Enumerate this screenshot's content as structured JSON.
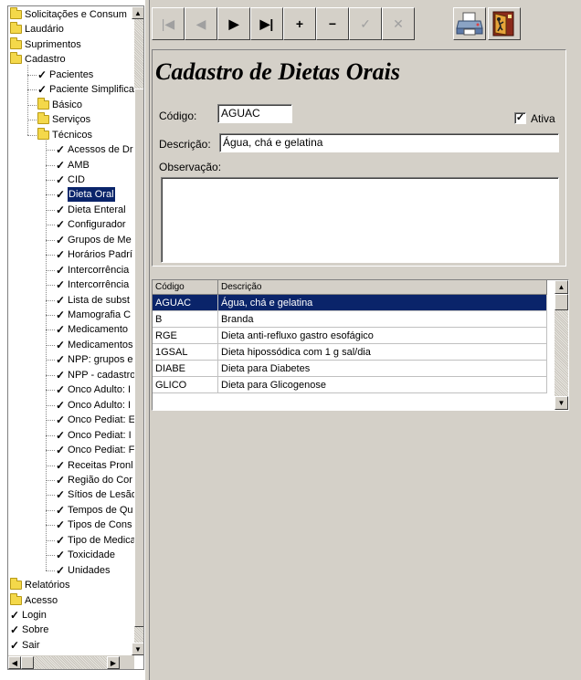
{
  "tree": {
    "items": [
      {
        "label": "Solicitações e Consum",
        "icon": "folder-icon",
        "level": 0
      },
      {
        "label": "Laudário",
        "icon": "folder-icon",
        "level": 0
      },
      {
        "label": "Suprimentos",
        "icon": "folder-icon",
        "level": 0
      },
      {
        "label": "Cadastro",
        "icon": "folder-icon",
        "level": 0
      },
      {
        "label": "Pacientes",
        "icon": "check-icon",
        "level": 1
      },
      {
        "label": "Paciente Simplifica",
        "icon": "check-icon",
        "level": 1
      },
      {
        "label": "Básico",
        "icon": "folder-icon",
        "level": 1
      },
      {
        "label": "Serviços",
        "icon": "folder-icon",
        "level": 1
      },
      {
        "label": "Técnicos",
        "icon": "folder-icon",
        "level": 1
      },
      {
        "label": "Acessos de Dr",
        "icon": "check-icon",
        "level": 2
      },
      {
        "label": "AMB",
        "icon": "check-icon",
        "level": 2
      },
      {
        "label": "CID",
        "icon": "check-icon",
        "level": 2
      },
      {
        "label": "Dieta Oral",
        "icon": "check-icon",
        "level": 2,
        "selected": true
      },
      {
        "label": "Dieta Enteral",
        "icon": "check-icon",
        "level": 2
      },
      {
        "label": "Configurador",
        "icon": "check-icon",
        "level": 2
      },
      {
        "label": "Grupos de Me",
        "icon": "check-icon",
        "level": 2
      },
      {
        "label": "Horários Padrí",
        "icon": "check-icon",
        "level": 2
      },
      {
        "label": "Intercorrência",
        "icon": "check-icon",
        "level": 2
      },
      {
        "label": "Intercorrência",
        "icon": "check-icon",
        "level": 2
      },
      {
        "label": "Lista de subst",
        "icon": "check-icon",
        "level": 2
      },
      {
        "label": "Mamografia C",
        "icon": "check-icon",
        "level": 2
      },
      {
        "label": "Medicamento",
        "icon": "check-icon",
        "level": 2
      },
      {
        "label": "Medicamentos",
        "icon": "check-icon",
        "level": 2
      },
      {
        "label": "NPP: grupos e",
        "icon": "check-icon",
        "level": 2
      },
      {
        "label": "NPP - cadastro",
        "icon": "check-icon",
        "level": 2
      },
      {
        "label": "Onco Adulto: I",
        "icon": "check-icon",
        "level": 2
      },
      {
        "label": "Onco Adulto: I",
        "icon": "check-icon",
        "level": 2
      },
      {
        "label": "Onco Pediat: E",
        "icon": "check-icon",
        "level": 2
      },
      {
        "label": "Onco Pediat: I",
        "icon": "check-icon",
        "level": 2
      },
      {
        "label": "Onco Pediat: F",
        "icon": "check-icon",
        "level": 2
      },
      {
        "label": "Receitas Pronl",
        "icon": "check-icon",
        "level": 2
      },
      {
        "label": "Região do Cor",
        "icon": "check-icon",
        "level": 2
      },
      {
        "label": "Sítios de Lesão",
        "icon": "check-icon",
        "level": 2
      },
      {
        "label": "Tempos de Qu",
        "icon": "check-icon",
        "level": 2
      },
      {
        "label": "Tipos de Cons",
        "icon": "check-icon",
        "level": 2
      },
      {
        "label": "Tipo de Medica",
        "icon": "check-icon",
        "level": 2
      },
      {
        "label": "Toxicidade",
        "icon": "check-icon",
        "level": 2
      },
      {
        "label": "Unidades",
        "icon": "check-icon",
        "level": 2
      },
      {
        "label": "Relatórios",
        "icon": "folder-icon",
        "level": 0
      },
      {
        "label": "Acesso",
        "icon": "folder-icon",
        "level": 0
      },
      {
        "label": "Login",
        "icon": "check-icon",
        "level": 0
      },
      {
        "label": "Sobre",
        "icon": "check-icon",
        "level": 0
      },
      {
        "label": "Sair",
        "icon": "check-icon",
        "level": 0
      }
    ]
  },
  "toolbar": {
    "buttons": [
      {
        "name": "first-record-button",
        "glyph": "|◀",
        "enabled": false
      },
      {
        "name": "prior-record-button",
        "glyph": "◀",
        "enabled": false
      },
      {
        "name": "next-record-button",
        "glyph": "▶",
        "enabled": true
      },
      {
        "name": "last-record-button",
        "glyph": "▶|",
        "enabled": true
      },
      {
        "name": "insert-record-button",
        "glyph": "+",
        "enabled": true
      },
      {
        "name": "delete-record-button",
        "glyph": "−",
        "enabled": true
      },
      {
        "name": "post-record-button",
        "glyph": "✓",
        "enabled": false
      },
      {
        "name": "cancel-edit-button",
        "glyph": "✕",
        "enabled": false
      }
    ],
    "print_icon": "printer-icon",
    "exit_icon": "exit-door-icon"
  },
  "form": {
    "title": "Cadastro de Dietas Orais",
    "codigo_label": "Código:",
    "codigo_value": "AGUAC",
    "ativa_label": "Ativa",
    "ativa_checked": "✓",
    "descricao_label": "Descrição:",
    "descricao_value": "Água, chá e gelatina",
    "observacao_label": "Observação:",
    "observacao_value": ""
  },
  "grid": {
    "columns": [
      "Código",
      "Descrição"
    ],
    "rows": [
      {
        "codigo": "AGUAC",
        "descricao": "Água, chá e gelatina",
        "selected": true
      },
      {
        "codigo": "B",
        "descricao": "Branda"
      },
      {
        "codigo": "RGE",
        "descricao": "Dieta anti-refluxo gastro esofágico"
      },
      {
        "codigo": "1GSAL",
        "descricao": "Dieta hipossódica com 1 g sal/dia"
      },
      {
        "codigo": "DIABE",
        "descricao": "Dieta para Diabetes"
      },
      {
        "codigo": "GLICO",
        "descricao": "Dieta para Glicogenose"
      }
    ]
  }
}
